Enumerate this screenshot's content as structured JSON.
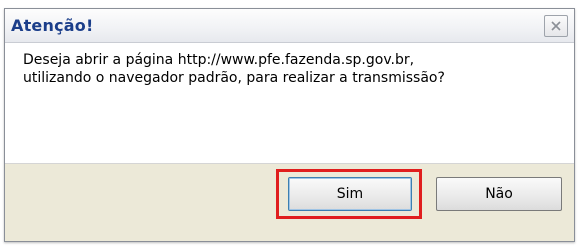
{
  "dialog": {
    "title": "Atenção!",
    "close_icon": "close-x-icon",
    "message_lines": [
      "Deseja abrir a página http://www.pfe.fazenda.sp.gov.br,",
      "utilizando o navegador padrão, para realizar a transmissão?"
    ],
    "buttons": {
      "yes_label": "Sim",
      "no_label": "Não"
    },
    "highlight_color": "#e01e1e",
    "title_color": "#1b3e8a"
  }
}
